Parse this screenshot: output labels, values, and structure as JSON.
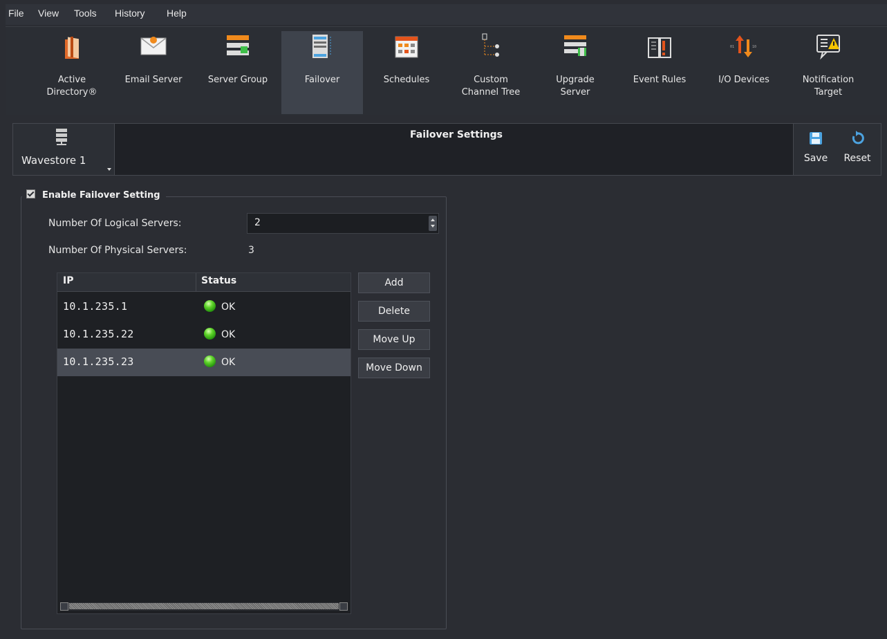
{
  "menu": [
    "File",
    "View",
    "Tools",
    "History",
    "Help"
  ],
  "toolbar": [
    {
      "label": "Active\nDirectory®",
      "icon": "active-directory-icon"
    },
    {
      "label": "Email Server",
      "icon": "email-server-icon"
    },
    {
      "label": "Server Group",
      "icon": "server-group-icon"
    },
    {
      "label": "Failover",
      "icon": "failover-icon",
      "active": true
    },
    {
      "label": "Schedules",
      "icon": "schedules-icon"
    },
    {
      "label": "Custom\nChannel Tree",
      "icon": "channel-tree-icon"
    },
    {
      "label": "Upgrade\nServer",
      "icon": "upgrade-server-icon"
    },
    {
      "label": "Event Rules",
      "icon": "event-rules-icon"
    },
    {
      "label": "I/O Devices",
      "icon": "io-devices-icon"
    },
    {
      "label": "Notification\nTarget",
      "icon": "notification-target-icon"
    }
  ],
  "header": {
    "server": "Wavestore 1",
    "title": "Failover Settings",
    "save": "Save",
    "reset": "Reset"
  },
  "failover": {
    "enable_label": "Enable Failover Setting",
    "enabled": true,
    "logical_label": "Number Of Logical Servers:",
    "logical_value": "2",
    "physical_label": "Number Of Physical Servers:",
    "physical_value": "3"
  },
  "table": {
    "columns": [
      "IP",
      "Status"
    ],
    "rows": [
      {
        "ip": "10.1.235.1",
        "status": "OK"
      },
      {
        "ip": "10.1.235.22",
        "status": "OK"
      },
      {
        "ip": "10.1.235.23",
        "status": "OK"
      }
    ],
    "selected_row": 2
  },
  "buttons": {
    "add": "Add",
    "delete": "Delete",
    "move_up": "Move Up",
    "move_down": "Move Down"
  },
  "colors": {
    "background": "#2b2d33",
    "status_ok": "#5fd42a",
    "accent_blue": "#4ca3e0",
    "accent_orange": "#f08a1c"
  }
}
